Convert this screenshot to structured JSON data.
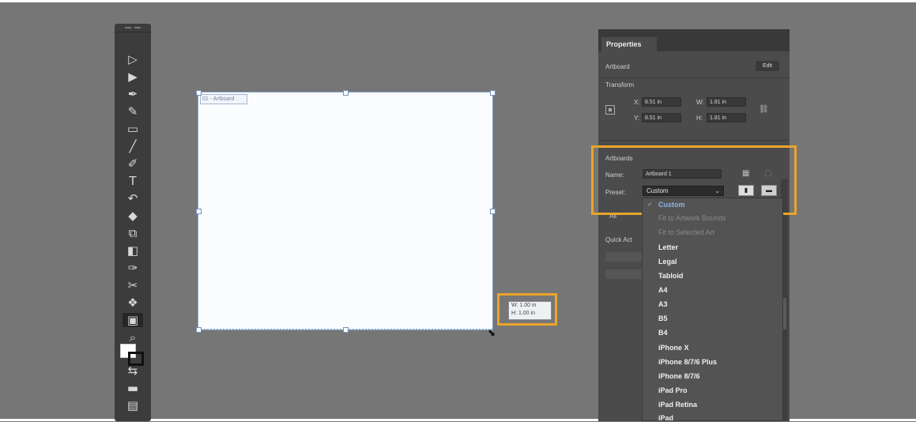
{
  "toolbar": {
    "tools": [
      {
        "name": "selection-tool",
        "glyph": "▷"
      },
      {
        "name": "direct-selection-tool",
        "glyph": "▶"
      },
      {
        "name": "pen-tool",
        "glyph": "✒"
      },
      {
        "name": "curvature-tool",
        "glyph": "✎"
      },
      {
        "name": "rectangle-tool",
        "glyph": "▭"
      },
      {
        "name": "paintbrush-tool",
        "glyph": "╱"
      },
      {
        "name": "pencil-tool",
        "glyph": "✐"
      },
      {
        "name": "type-tool",
        "glyph": "T"
      },
      {
        "name": "rotate-tool",
        "glyph": "↶"
      },
      {
        "name": "eraser-tool",
        "glyph": "◆"
      },
      {
        "name": "free-transform-tool",
        "glyph": "⧉"
      },
      {
        "name": "shape-builder-tool",
        "glyph": "◧"
      },
      {
        "name": "eyedropper-tool",
        "glyph": "✑"
      },
      {
        "name": "scissors-tool",
        "glyph": "✂"
      },
      {
        "name": "blend-tool",
        "glyph": "❖"
      },
      {
        "name": "artboard-tool",
        "glyph": "▣"
      },
      {
        "name": "zoom-tool",
        "glyph": "⌕"
      },
      {
        "name": "swap-colors-tool",
        "glyph": "⇆"
      },
      {
        "name": "draw-mode-tool",
        "glyph": "▬"
      },
      {
        "name": "screen-mode-tool",
        "glyph": "▤"
      }
    ]
  },
  "canvas": {
    "artboard_label": "01 - Artboard",
    "measure": {
      "width": "W: 1.00 in",
      "height": "H: 1.00 in"
    }
  },
  "properties": {
    "tab": "Properties",
    "artboard_label": "Artboard",
    "edit_button": "Edit",
    "transform_label": "Transform",
    "x_label": "X:",
    "x_value": "8.51 in",
    "w_label": "W:",
    "w_value": "1.81 in",
    "y_label": "Y:",
    "y_value": "8.51 in",
    "h_label": "H:",
    "h_value": "1.81 in",
    "artboards_heading": "Artboards",
    "name_label": "Name:",
    "name_value": "Artboard 1",
    "preset_label": "Preset:",
    "preset_value": "Custom",
    "all_label": "All",
    "quick_actions_label": "Quick Act"
  },
  "preset_dropdown": {
    "items": [
      {
        "label": "Custom",
        "state": "selected"
      },
      {
        "label": "Fit to Artwork Bounds",
        "state": "disabled"
      },
      {
        "label": "Fit to Selected Art",
        "state": "disabled"
      },
      {
        "label": "Letter",
        "state": "normal"
      },
      {
        "label": "Legal",
        "state": "normal"
      },
      {
        "label": "Tabloid",
        "state": "normal"
      },
      {
        "label": "A4",
        "state": "normal"
      },
      {
        "label": "A3",
        "state": "normal"
      },
      {
        "label": "B5",
        "state": "normal"
      },
      {
        "label": "B4",
        "state": "normal"
      },
      {
        "label": "iPhone X",
        "state": "normal"
      },
      {
        "label": "iPhone 8/7/6 Plus",
        "state": "normal"
      },
      {
        "label": "iPhone 8/7/6",
        "state": "normal"
      },
      {
        "label": "iPad Pro",
        "state": "normal"
      },
      {
        "label": "iPad Retina",
        "state": "normal"
      },
      {
        "label": "iPad",
        "state": "normal"
      }
    ]
  },
  "colors": {
    "highlight": "#eaa52a",
    "selected_item": "#8fb4e4",
    "artboard_stroke": "#7fa2c8"
  }
}
